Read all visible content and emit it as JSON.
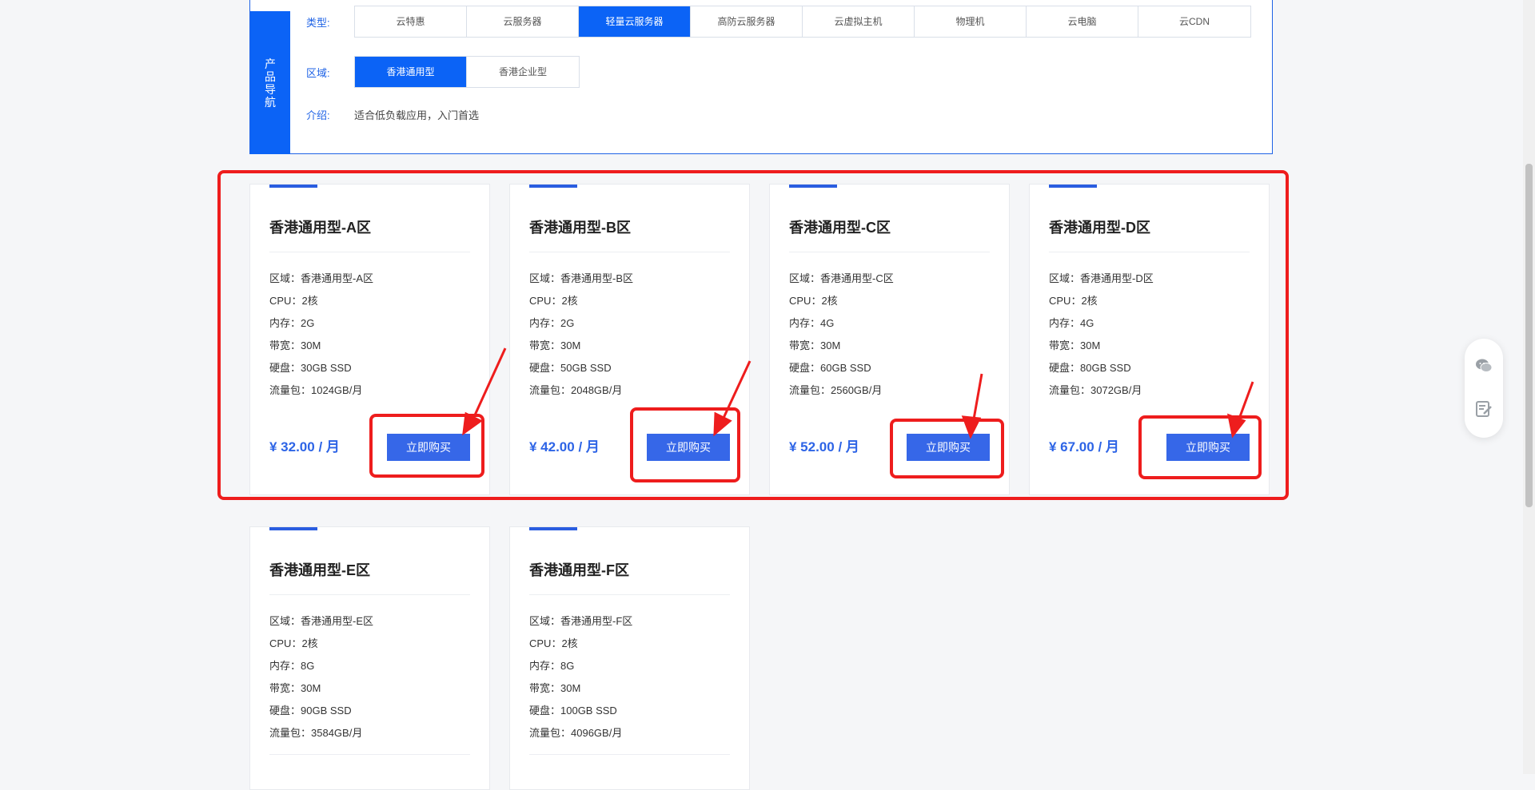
{
  "nav": {
    "side_label": "产品导航",
    "type_label": "类型:",
    "types": [
      "云特惠",
      "云服务器",
      "轻量云服务器",
      "高防云服务器",
      "云虚拟主机",
      "物理机",
      "云电脑",
      "云CDN"
    ],
    "type_active_index": 2,
    "region_label": "区域:",
    "regions": [
      "香港通用型",
      "香港企业型"
    ],
    "region_active_index": 0,
    "intro_label": "介绍:",
    "intro_text": "适合低负载应用，入门首选"
  },
  "cards": [
    {
      "title": "香港通用型-A区",
      "region": "区域：香港通用型-A区",
      "cpu": "CPU：2核",
      "memory": "内存：2G",
      "bandwidth": "带宽：30M",
      "disk": "硬盘：30GB SSD",
      "traffic": "流量包：1024GB/月",
      "price": "¥ 32.00 / 月",
      "buy": "立即购买"
    },
    {
      "title": "香港通用型-B区",
      "region": "区域：香港通用型-B区",
      "cpu": "CPU：2核",
      "memory": "内存：2G",
      "bandwidth": "带宽：30M",
      "disk": "硬盘：50GB SSD",
      "traffic": "流量包：2048GB/月",
      "price": "¥ 42.00 / 月",
      "buy": "立即购买"
    },
    {
      "title": "香港通用型-C区",
      "region": "区域：香港通用型-C区",
      "cpu": "CPU：2核",
      "memory": "内存：4G",
      "bandwidth": "带宽：30M",
      "disk": "硬盘：60GB SSD",
      "traffic": "流量包：2560GB/月",
      "price": "¥ 52.00 / 月",
      "buy": "立即购买"
    },
    {
      "title": "香港通用型-D区",
      "region": "区域：香港通用型-D区",
      "cpu": "CPU：2核",
      "memory": "内存：4G",
      "bandwidth": "带宽：30M",
      "disk": "硬盘：80GB SSD",
      "traffic": "流量包：3072GB/月",
      "price": "¥ 67.00 / 月",
      "buy": "立即购买"
    },
    {
      "title": "香港通用型-E区",
      "region": "区域：香港通用型-E区",
      "cpu": "CPU：2核",
      "memory": "内存：8G",
      "bandwidth": "带宽：30M",
      "disk": "硬盘：90GB SSD",
      "traffic": "流量包：3584GB/月"
    },
    {
      "title": "香港通用型-F区",
      "region": "区域：香港通用型-F区",
      "cpu": "CPU：2核",
      "memory": "内存：8G",
      "bandwidth": "带宽：30M",
      "disk": "硬盘：100GB SSD",
      "traffic": "流量包：4096GB/月"
    }
  ],
  "float_bar": {
    "icons": [
      "wechat-icon",
      "edit-note-icon"
    ]
  },
  "colors": {
    "accent": "#0b63f6",
    "annotation": "#ee1d1d",
    "price": "#2d64e6"
  }
}
